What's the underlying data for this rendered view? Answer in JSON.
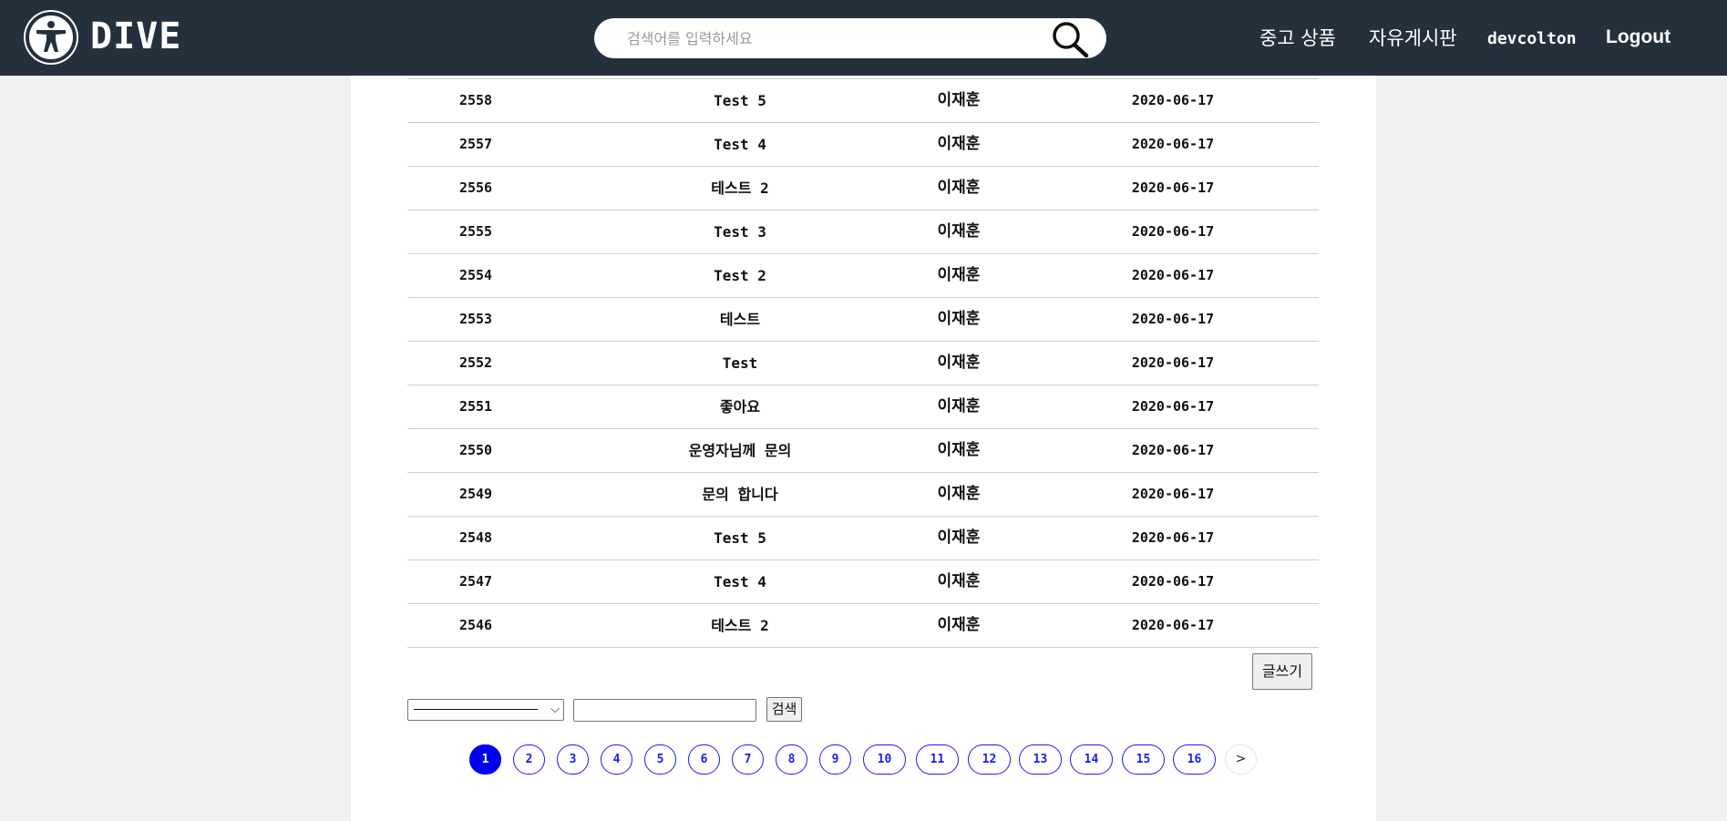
{
  "header": {
    "logo_text": "DIVE",
    "search_placeholder": "검색어를 입력하세요",
    "nav": {
      "used_goods": "중고 상품",
      "free_board": "자유게시판",
      "username": "devcolton",
      "logout": "Logout"
    }
  },
  "posts": [
    {
      "num": "2558",
      "title": "Test 5",
      "author": "이재훈",
      "date": "2020-06-17"
    },
    {
      "num": "2557",
      "title": "Test 4",
      "author": "이재훈",
      "date": "2020-06-17"
    },
    {
      "num": "2556",
      "title": "테스트 2",
      "author": "이재훈",
      "date": "2020-06-17"
    },
    {
      "num": "2555",
      "title": "Test 3",
      "author": "이재훈",
      "date": "2020-06-17"
    },
    {
      "num": "2554",
      "title": "Test 2",
      "author": "이재훈",
      "date": "2020-06-17"
    },
    {
      "num": "2553",
      "title": "테스트",
      "author": "이재훈",
      "date": "2020-06-17"
    },
    {
      "num": "2552",
      "title": "Test",
      "author": "이재훈",
      "date": "2020-06-17"
    },
    {
      "num": "2551",
      "title": "좋아요",
      "author": "이재훈",
      "date": "2020-06-17"
    },
    {
      "num": "2550",
      "title": "운영자님께 문의",
      "author": "이재훈",
      "date": "2020-06-17"
    },
    {
      "num": "2549",
      "title": "문의 합니다",
      "author": "이재훈",
      "date": "2020-06-17"
    },
    {
      "num": "2548",
      "title": "Test 5",
      "author": "이재훈",
      "date": "2020-06-17"
    },
    {
      "num": "2547",
      "title": "Test 4",
      "author": "이재훈",
      "date": "2020-06-17"
    },
    {
      "num": "2546",
      "title": "테스트 2",
      "author": "이재훈",
      "date": "2020-06-17"
    }
  ],
  "write_button": "글쓰기",
  "search": {
    "select_value": "",
    "input_value": "",
    "submit_label": "검색"
  },
  "pagination": {
    "pages": [
      "1",
      "2",
      "3",
      "4",
      "5",
      "6",
      "7",
      "8",
      "9",
      "10",
      "11",
      "12",
      "13",
      "14",
      "15",
      "16"
    ],
    "current": "1",
    "next_label": ">"
  },
  "colors": {
    "header_bg": "#25303d",
    "page_link": "#1a1aff",
    "page_active": "#0000ee"
  }
}
